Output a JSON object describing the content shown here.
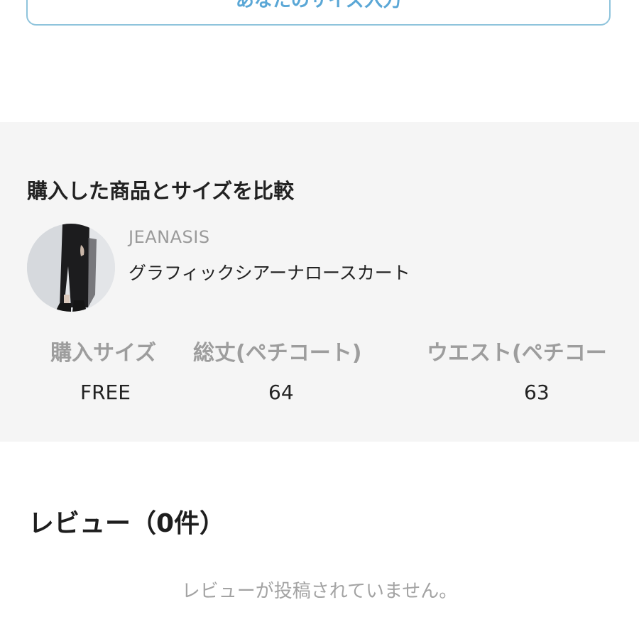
{
  "top_button": {
    "label": "あなたのサイズ入力"
  },
  "compare": {
    "heading": "購入した商品とサイズを比較",
    "product": {
      "brand": "JEANASIS",
      "name": "グラフィックシアーナロースカート",
      "image_alt": "product-photo-black-skirt"
    },
    "size_table": {
      "headers": [
        "購入サイズ",
        "総丈(ペチコート)",
        "ウエスト(ペチコー"
      ],
      "values": [
        "FREE",
        "64",
        "63"
      ]
    }
  },
  "reviews": {
    "heading": "レビュー（0件）",
    "empty_message": "レビューが投稿されていません。"
  }
}
